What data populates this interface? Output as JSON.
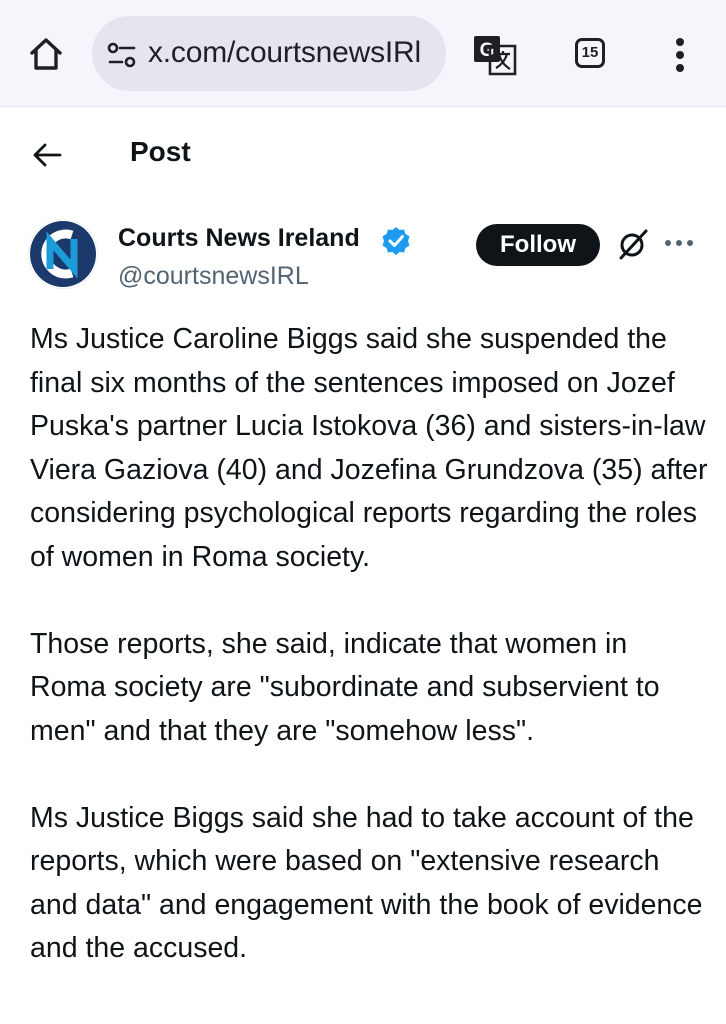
{
  "browser": {
    "url": "x.com/courtsnewsIRl",
    "tab_count": "15",
    "icons": [
      "home-icon",
      "site-settings-icon",
      "translate-icon",
      "more-vert-icon"
    ]
  },
  "header": {
    "title": "Post",
    "back_icon": "arrow-left-icon"
  },
  "author": {
    "display_name": "Courts News Ireland",
    "handle": "@courtsnewsIRL",
    "verified": true,
    "follow_label": "Follow"
  },
  "post": {
    "paragraphs": [
      "Ms Justice Caroline Biggs said she suspended the final six months of the sentences imposed on Jozef Puska's partner Lucia Istokova (36) and sisters-in-law Viera Gaziova (40) and Jozefina Grundzova (35) after considering psychological reports regarding the roles of women in Roma society.",
      "Those reports, she said, indicate that women in Roma society are \"subordinate and subservient to men\" and that they are \"somehow less\".",
      "Ms Justice Biggs said she had to take account of the reports, which were based on \"extensive research and data\" and engagement with the book of evidence and the accused."
    ]
  },
  "colors": {
    "accent_blue": "#1d9bf0",
    "text_primary": "#0f1419",
    "text_secondary": "#536471",
    "logo_blue": "#1b3a6b"
  }
}
